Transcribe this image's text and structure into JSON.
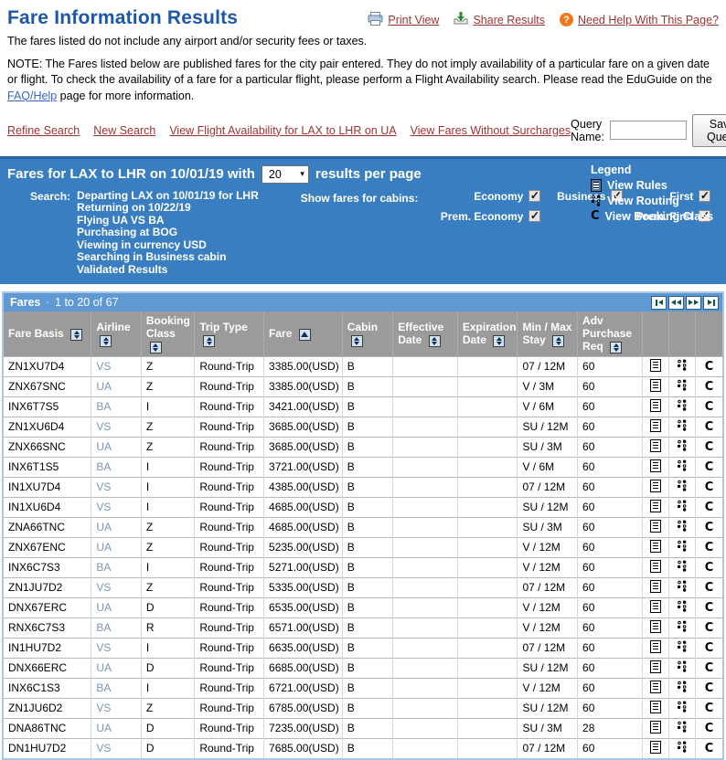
{
  "page": {
    "title": "Fare Information Results",
    "subtitle": "The fares listed do not include any airport and/or security fees or taxes.",
    "note_part1": "NOTE: The Fares listed below are published fares for the city pair entered. They do not imply availability of a particular fare on a given date or flight. To check the availability of a fare for a particular flight, please perform a Flight Availability search. Please read the EduGuide on the ",
    "note_link": "FAQ/Help",
    "note_part2": " page for more information."
  },
  "header_links": {
    "print": "Print View",
    "share": "Share Results",
    "help": "Need Help With This Page?"
  },
  "actions": {
    "links": [
      "Refine Search",
      "New Search",
      "View Flight Availability for LAX to LHR on UA",
      "View Fares Without Surcharges"
    ],
    "query_name_label": "Query Name:",
    "query_name_value": "",
    "save_button": "Save Query"
  },
  "results_panel": {
    "title_prefix": "Fares for LAX to LHR on 10/01/19 with",
    "results_per_page_value": "20",
    "title_suffix": "results per page",
    "search_label": "Search:",
    "search_criteria": [
      "Departing LAX on 10/01/19 for LHR",
      "Returning on 10/22/19",
      "Flying UA VS BA",
      "Purchasing at BOG",
      "Viewing in currency USD",
      "Searching in Business cabin",
      "Validated Results"
    ],
    "cabins_label": "Show fares for cabins:",
    "cabin_rows": [
      [
        {
          "label": "Economy",
          "checked": true
        },
        {
          "label": "Business",
          "checked": true
        },
        {
          "label": "First",
          "checked": true
        }
      ],
      [
        {
          "label": "Prem. Economy",
          "checked": true
        },
        null,
        {
          "label": "Prem. First",
          "checked": true
        }
      ]
    ],
    "legend": {
      "title": "Legend",
      "items": [
        "View Rules",
        "View Routing",
        "View Booking Class"
      ]
    }
  },
  "fares_table": {
    "bar_title": "Fares",
    "range_text": "1 to 20 of 67",
    "pagination": [
      "first-page",
      "previous-page",
      "next-page",
      "last-page"
    ],
    "columns": [
      {
        "label": "Fare Basis",
        "sort": "both"
      },
      {
        "label": "Airline",
        "sort": "both"
      },
      {
        "label": "Booking Class",
        "sort": "both"
      },
      {
        "label": "Trip Type",
        "sort": "both"
      },
      {
        "label": "Fare",
        "sort": "asc"
      },
      {
        "label": "Cabin",
        "sort": "both"
      },
      {
        "label": "Effective Date",
        "sort": "both"
      },
      {
        "label": "Expiration Date",
        "sort": "both"
      },
      {
        "label": "Min / Max Stay",
        "sort": "both"
      },
      {
        "label": "Adv Purchase Req",
        "sort": "both"
      },
      {
        "label": "",
        "icon": "view-rules"
      },
      {
        "label": "",
        "icon": "view-routing"
      },
      {
        "label": "",
        "icon": "view-booking-class"
      }
    ],
    "row_fields": [
      "fare_basis",
      "airline",
      "booking_class",
      "trip_type",
      "fare",
      "cabin",
      "effective_date",
      "expiration_date",
      "min_max_stay",
      "adv_purchase_req"
    ],
    "rows": [
      {
        "fare_basis": "ZN1XU7D4",
        "airline": "VS",
        "booking_class": "Z",
        "trip_type": "Round-Trip",
        "fare": "3385.00(USD)",
        "cabin": "B",
        "effective_date": "",
        "expiration_date": "",
        "min_max_stay": "07 / 12M",
        "adv_purchase_req": "60"
      },
      {
        "fare_basis": "ZNX67SNC",
        "airline": "UA",
        "booking_class": "Z",
        "trip_type": "Round-Trip",
        "fare": "3385.00(USD)",
        "cabin": "B",
        "effective_date": "",
        "expiration_date": "",
        "min_max_stay": "V / 3M",
        "adv_purchase_req": "60"
      },
      {
        "fare_basis": "INX6T7S5",
        "airline": "BA",
        "booking_class": "I",
        "trip_type": "Round-Trip",
        "fare": "3421.00(USD)",
        "cabin": "B",
        "effective_date": "",
        "expiration_date": "",
        "min_max_stay": "V / 6M",
        "adv_purchase_req": "60"
      },
      {
        "fare_basis": "ZN1XU6D4",
        "airline": "VS",
        "booking_class": "Z",
        "trip_type": "Round-Trip",
        "fare": "3685.00(USD)",
        "cabin": "B",
        "effective_date": "",
        "expiration_date": "",
        "min_max_stay": "SU / 12M",
        "adv_purchase_req": "60"
      },
      {
        "fare_basis": "ZNX66SNC",
        "airline": "UA",
        "booking_class": "Z",
        "trip_type": "Round-Trip",
        "fare": "3685.00(USD)",
        "cabin": "B",
        "effective_date": "",
        "expiration_date": "",
        "min_max_stay": "SU / 3M",
        "adv_purchase_req": "60"
      },
      {
        "fare_basis": "INX6T1S5",
        "airline": "BA",
        "booking_class": "I",
        "trip_type": "Round-Trip",
        "fare": "3721.00(USD)",
        "cabin": "B",
        "effective_date": "",
        "expiration_date": "",
        "min_max_stay": "V / 6M",
        "adv_purchase_req": "60"
      },
      {
        "fare_basis": "IN1XU7D4",
        "airline": "VS",
        "booking_class": "I",
        "trip_type": "Round-Trip",
        "fare": "4385.00(USD)",
        "cabin": "B",
        "effective_date": "",
        "expiration_date": "",
        "min_max_stay": "07 / 12M",
        "adv_purchase_req": "60"
      },
      {
        "fare_basis": "IN1XU6D4",
        "airline": "VS",
        "booking_class": "I",
        "trip_type": "Round-Trip",
        "fare": "4685.00(USD)",
        "cabin": "B",
        "effective_date": "",
        "expiration_date": "",
        "min_max_stay": "SU / 12M",
        "adv_purchase_req": "60"
      },
      {
        "fare_basis": "ZNA66TNC",
        "airline": "UA",
        "booking_class": "Z",
        "trip_type": "Round-Trip",
        "fare": "4685.00(USD)",
        "cabin": "B",
        "effective_date": "",
        "expiration_date": "",
        "min_max_stay": "SU / 3M",
        "adv_purchase_req": "60"
      },
      {
        "fare_basis": "ZNX67ENC",
        "airline": "UA",
        "booking_class": "Z",
        "trip_type": "Round-Trip",
        "fare": "5235.00(USD)",
        "cabin": "B",
        "effective_date": "",
        "expiration_date": "",
        "min_max_stay": "V / 12M",
        "adv_purchase_req": "60"
      },
      {
        "fare_basis": "INX6C7S3",
        "airline": "BA",
        "booking_class": "I",
        "trip_type": "Round-Trip",
        "fare": "5271.00(USD)",
        "cabin": "B",
        "effective_date": "",
        "expiration_date": "",
        "min_max_stay": "V / 12M",
        "adv_purchase_req": "60"
      },
      {
        "fare_basis": "ZN1JU7D2",
        "airline": "VS",
        "booking_class": "Z",
        "trip_type": "Round-Trip",
        "fare": "5335.00(USD)",
        "cabin": "B",
        "effective_date": "",
        "expiration_date": "",
        "min_max_stay": "07 / 12M",
        "adv_purchase_req": "60"
      },
      {
        "fare_basis": "DNX67ERC",
        "airline": "UA",
        "booking_class": "D",
        "trip_type": "Round-Trip",
        "fare": "6535.00(USD)",
        "cabin": "B",
        "effective_date": "",
        "expiration_date": "",
        "min_max_stay": "V / 12M",
        "adv_purchase_req": "60"
      },
      {
        "fare_basis": "RNX6C7S3",
        "airline": "BA",
        "booking_class": "R",
        "trip_type": "Round-Trip",
        "fare": "6571.00(USD)",
        "cabin": "B",
        "effective_date": "",
        "expiration_date": "",
        "min_max_stay": "V / 12M",
        "adv_purchase_req": "60"
      },
      {
        "fare_basis": "IN1HU7D2",
        "airline": "VS",
        "booking_class": "I",
        "trip_type": "Round-Trip",
        "fare": "6635.00(USD)",
        "cabin": "B",
        "effective_date": "",
        "expiration_date": "",
        "min_max_stay": "07 / 12M",
        "adv_purchase_req": "60"
      },
      {
        "fare_basis": "DNX66ERC",
        "airline": "UA",
        "booking_class": "D",
        "trip_type": "Round-Trip",
        "fare": "6685.00(USD)",
        "cabin": "B",
        "effective_date": "",
        "expiration_date": "",
        "min_max_stay": "SU / 12M",
        "adv_purchase_req": "60"
      },
      {
        "fare_basis": "INX6C1S3",
        "airline": "BA",
        "booking_class": "I",
        "trip_type": "Round-Trip",
        "fare": "6721.00(USD)",
        "cabin": "B",
        "effective_date": "",
        "expiration_date": "",
        "min_max_stay": "V / 12M",
        "adv_purchase_req": "60"
      },
      {
        "fare_basis": "ZN1JU6D2",
        "airline": "VS",
        "booking_class": "Z",
        "trip_type": "Round-Trip",
        "fare": "6785.00(USD)",
        "cabin": "B",
        "effective_date": "",
        "expiration_date": "",
        "min_max_stay": "SU / 12M",
        "adv_purchase_req": "60"
      },
      {
        "fare_basis": "DNA86TNC",
        "airline": "UA",
        "booking_class": "D",
        "trip_type": "Round-Trip",
        "fare": "7235.00(USD)",
        "cabin": "B",
        "effective_date": "",
        "expiration_date": "",
        "min_max_stay": "SU / 3M",
        "adv_purchase_req": "28"
      },
      {
        "fare_basis": "DN1HU7D2",
        "airline": "VS",
        "booking_class": "D",
        "trip_type": "Round-Trip",
        "fare": "7685.00(USD)",
        "cabin": "B",
        "effective_date": "",
        "expiration_date": "",
        "min_max_stay": "07 / 12M",
        "adv_purchase_req": "60"
      }
    ]
  },
  "colors": {
    "title_blue": "#1c57a8",
    "link_maroon": "#9c3333",
    "panel_blue": "#3a7ec2",
    "bar_blue": "#5e99d4",
    "header_gray": "#9b9b9b",
    "frame_light_blue": "#a7c9e9",
    "airline_link": "#7b96b3",
    "help_orange": "#f07818"
  }
}
